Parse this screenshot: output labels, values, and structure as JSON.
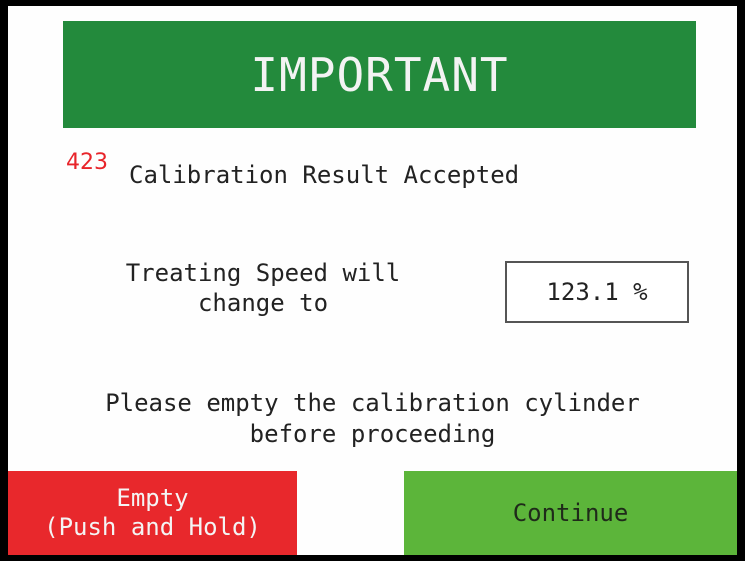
{
  "header": {
    "title": "IMPORTANT"
  },
  "message": {
    "code": "423",
    "text": "Calibration Result Accepted"
  },
  "speed": {
    "label_line1": "Treating Speed will",
    "label_line2": "change to",
    "value": "123.1 %"
  },
  "instruction": {
    "line1": "Please empty the calibration cylinder",
    "line2": "before proceeding"
  },
  "buttons": {
    "empty_line1": "Empty",
    "empty_line2": "(Push and Hold)",
    "continue": "Continue"
  },
  "colors": {
    "header_bg": "#238a3c",
    "code_red": "#e8242a",
    "empty_button": "#e8282c",
    "continue_button": "#5cb53a"
  }
}
